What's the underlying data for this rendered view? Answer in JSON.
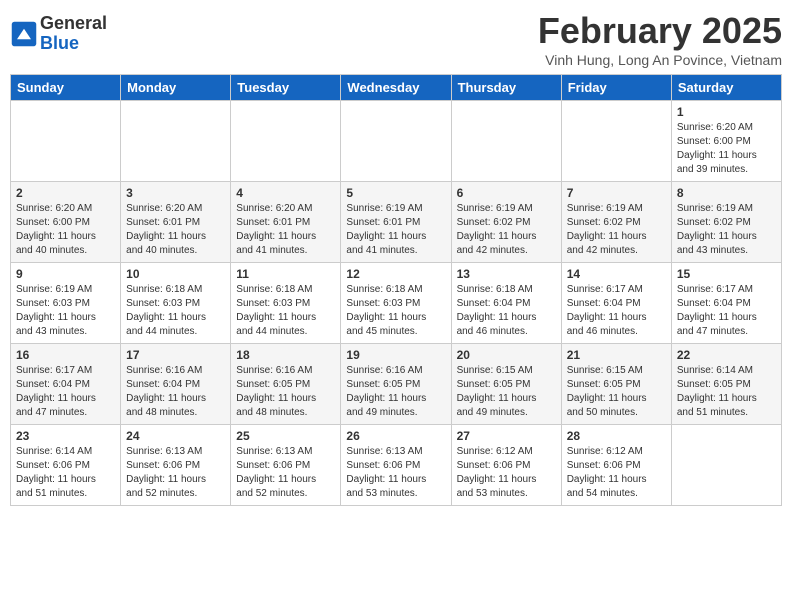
{
  "logo": {
    "line1": "General",
    "line2": "Blue"
  },
  "title": {
    "month_year": "February 2025",
    "location": "Vinh Hung, Long An Povince, Vietnam"
  },
  "weekdays": [
    "Sunday",
    "Monday",
    "Tuesday",
    "Wednesday",
    "Thursday",
    "Friday",
    "Saturday"
  ],
  "weeks": [
    [
      {
        "day": "",
        "info": ""
      },
      {
        "day": "",
        "info": ""
      },
      {
        "day": "",
        "info": ""
      },
      {
        "day": "",
        "info": ""
      },
      {
        "day": "",
        "info": ""
      },
      {
        "day": "",
        "info": ""
      },
      {
        "day": "1",
        "info": "Sunrise: 6:20 AM\nSunset: 6:00 PM\nDaylight: 11 hours\nand 39 minutes."
      }
    ],
    [
      {
        "day": "2",
        "info": "Sunrise: 6:20 AM\nSunset: 6:00 PM\nDaylight: 11 hours\nand 40 minutes."
      },
      {
        "day": "3",
        "info": "Sunrise: 6:20 AM\nSunset: 6:01 PM\nDaylight: 11 hours\nand 40 minutes."
      },
      {
        "day": "4",
        "info": "Sunrise: 6:20 AM\nSunset: 6:01 PM\nDaylight: 11 hours\nand 41 minutes."
      },
      {
        "day": "5",
        "info": "Sunrise: 6:19 AM\nSunset: 6:01 PM\nDaylight: 11 hours\nand 41 minutes."
      },
      {
        "day": "6",
        "info": "Sunrise: 6:19 AM\nSunset: 6:02 PM\nDaylight: 11 hours\nand 42 minutes."
      },
      {
        "day": "7",
        "info": "Sunrise: 6:19 AM\nSunset: 6:02 PM\nDaylight: 11 hours\nand 42 minutes."
      },
      {
        "day": "8",
        "info": "Sunrise: 6:19 AM\nSunset: 6:02 PM\nDaylight: 11 hours\nand 43 minutes."
      }
    ],
    [
      {
        "day": "9",
        "info": "Sunrise: 6:19 AM\nSunset: 6:03 PM\nDaylight: 11 hours\nand 43 minutes."
      },
      {
        "day": "10",
        "info": "Sunrise: 6:18 AM\nSunset: 6:03 PM\nDaylight: 11 hours\nand 44 minutes."
      },
      {
        "day": "11",
        "info": "Sunrise: 6:18 AM\nSunset: 6:03 PM\nDaylight: 11 hours\nand 44 minutes."
      },
      {
        "day": "12",
        "info": "Sunrise: 6:18 AM\nSunset: 6:03 PM\nDaylight: 11 hours\nand 45 minutes."
      },
      {
        "day": "13",
        "info": "Sunrise: 6:18 AM\nSunset: 6:04 PM\nDaylight: 11 hours\nand 46 minutes."
      },
      {
        "day": "14",
        "info": "Sunrise: 6:17 AM\nSunset: 6:04 PM\nDaylight: 11 hours\nand 46 minutes."
      },
      {
        "day": "15",
        "info": "Sunrise: 6:17 AM\nSunset: 6:04 PM\nDaylight: 11 hours\nand 47 minutes."
      }
    ],
    [
      {
        "day": "16",
        "info": "Sunrise: 6:17 AM\nSunset: 6:04 PM\nDaylight: 11 hours\nand 47 minutes."
      },
      {
        "day": "17",
        "info": "Sunrise: 6:16 AM\nSunset: 6:04 PM\nDaylight: 11 hours\nand 48 minutes."
      },
      {
        "day": "18",
        "info": "Sunrise: 6:16 AM\nSunset: 6:05 PM\nDaylight: 11 hours\nand 48 minutes."
      },
      {
        "day": "19",
        "info": "Sunrise: 6:16 AM\nSunset: 6:05 PM\nDaylight: 11 hours\nand 49 minutes."
      },
      {
        "day": "20",
        "info": "Sunrise: 6:15 AM\nSunset: 6:05 PM\nDaylight: 11 hours\nand 49 minutes."
      },
      {
        "day": "21",
        "info": "Sunrise: 6:15 AM\nSunset: 6:05 PM\nDaylight: 11 hours\nand 50 minutes."
      },
      {
        "day": "22",
        "info": "Sunrise: 6:14 AM\nSunset: 6:05 PM\nDaylight: 11 hours\nand 51 minutes."
      }
    ],
    [
      {
        "day": "23",
        "info": "Sunrise: 6:14 AM\nSunset: 6:06 PM\nDaylight: 11 hours\nand 51 minutes."
      },
      {
        "day": "24",
        "info": "Sunrise: 6:13 AM\nSunset: 6:06 PM\nDaylight: 11 hours\nand 52 minutes."
      },
      {
        "day": "25",
        "info": "Sunrise: 6:13 AM\nSunset: 6:06 PM\nDaylight: 11 hours\nand 52 minutes."
      },
      {
        "day": "26",
        "info": "Sunrise: 6:13 AM\nSunset: 6:06 PM\nDaylight: 11 hours\nand 53 minutes."
      },
      {
        "day": "27",
        "info": "Sunrise: 6:12 AM\nSunset: 6:06 PM\nDaylight: 11 hours\nand 53 minutes."
      },
      {
        "day": "28",
        "info": "Sunrise: 6:12 AM\nSunset: 6:06 PM\nDaylight: 11 hours\nand 54 minutes."
      },
      {
        "day": "",
        "info": ""
      }
    ]
  ]
}
